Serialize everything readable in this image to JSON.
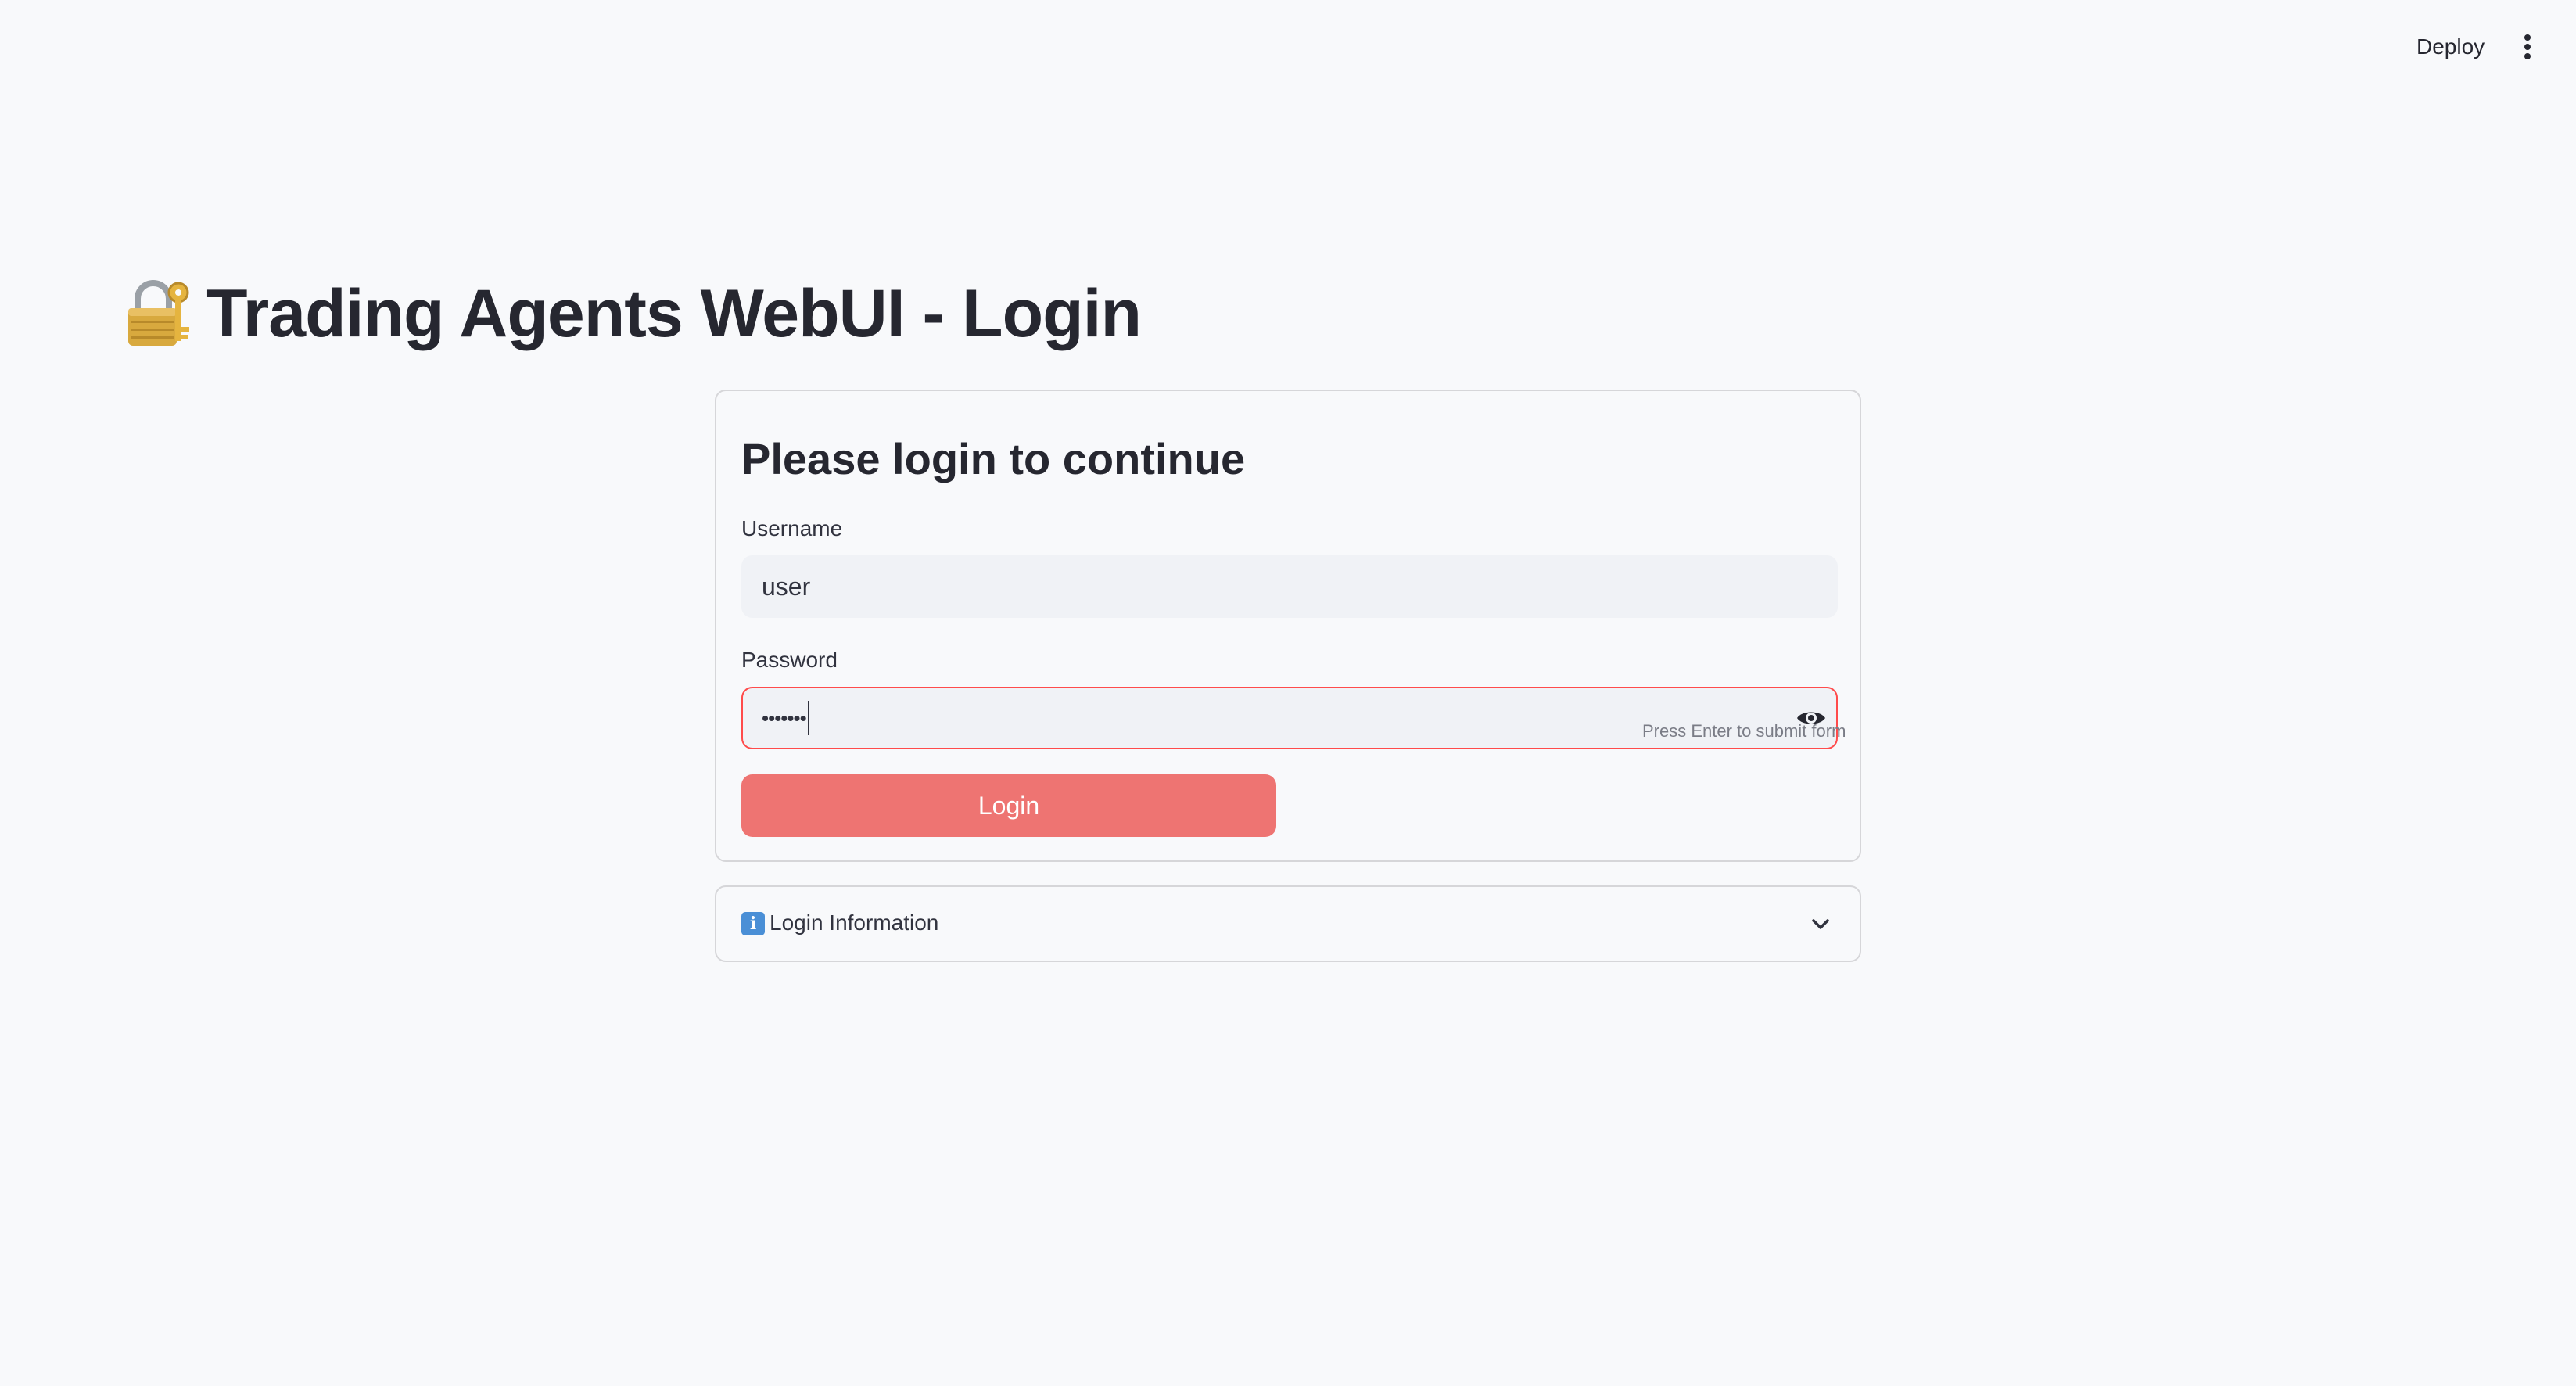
{
  "header": {
    "deploy_label": "Deploy"
  },
  "page": {
    "title": "Trading Agents WebUI - Login",
    "title_icon": "lock-with-key-icon"
  },
  "login_form": {
    "heading": "Please login to continue",
    "username": {
      "label": "Username",
      "value": "user"
    },
    "password": {
      "label": "Password",
      "masked_value": "•••••••",
      "hint": "Press Enter to submit form"
    },
    "submit_label": "Login"
  },
  "expander": {
    "label": "Login Information",
    "icon": "info-icon",
    "expanded": false
  },
  "colors": {
    "background": "#f8f9fb",
    "primary_button": "#ee7472",
    "error_border": "#ff4b4b",
    "text": "#262730"
  }
}
